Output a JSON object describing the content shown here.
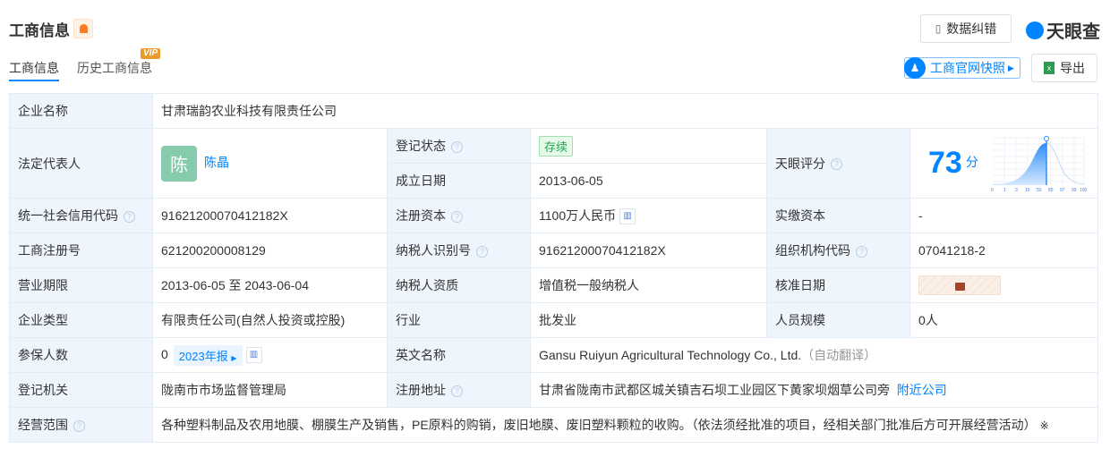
{
  "header": {
    "title": "工商信息",
    "tabs": [
      "工商信息",
      "历史工商信息"
    ],
    "vip": "VIP",
    "correct_btn": "数据纠错",
    "logo": "天眼查",
    "snapshot_btn": "工商官网快照",
    "export_btn": "导出"
  },
  "info": {
    "company_name_label": "企业名称",
    "company_name": "甘肃瑞韵农业科技有限责任公司",
    "legal_rep_label": "法定代表人",
    "legal_rep_avatar": "陈",
    "legal_rep": "陈晶",
    "status_label": "登记状态",
    "status": "存续",
    "founded_label": "成立日期",
    "founded": "2013-06-05",
    "score_label": "天眼评分",
    "score": "73",
    "score_unit": "分",
    "score_ticks": [
      "0",
      "1",
      "3",
      "15",
      "50",
      "85",
      "97",
      "99",
      "100"
    ],
    "credit_code_label": "统一社会信用代码",
    "credit_code": "91621200070412182X",
    "reg_capital_label": "注册资本",
    "reg_capital": "1100万人民币",
    "paid_capital_label": "实缴资本",
    "paid_capital": "-",
    "reg_no_label": "工商注册号",
    "reg_no": "621200200008129",
    "taxpayer_id_label": "纳税人识别号",
    "taxpayer_id": "91621200070412182X",
    "org_code_label": "组织机构代码",
    "org_code": "07041218-2",
    "term_label": "营业期限",
    "term": "2013-06-05 至 2043-06-04",
    "taxpayer_type_label": "纳税人资质",
    "taxpayer_type": "增值税一般纳税人",
    "approved_label": "核准日期",
    "type_label": "企业类型",
    "type": "有限责任公司(自然人投资或控股)",
    "industry_label": "行业",
    "industry": "批发业",
    "staff_label": "人员规模",
    "staff": "0人",
    "insured_label": "参保人数",
    "insured": "0",
    "report": "2023年报",
    "en_name_label": "英文名称",
    "en_name": "Gansu Ruiyun Agricultural Technology Co., Ltd.",
    "auto_translate": "（自动翻译）",
    "authority_label": "登记机关",
    "authority": "陇南市市场监督管理局",
    "address_label": "注册地址",
    "address": "甘肃省陇南市武都区城关镇吉石坝工业园区下黄家坝烟草公司旁",
    "nearby": "附近公司",
    "scope_label": "经营范围",
    "scope": "各种塑料制品及农用地膜、棚膜生产及销售，PE原料的购销，废旧地膜、废旧塑料颗粒的收购。（依法须经批准的项目，经相关部门批准后方可开展经营活动）",
    "scope_mark": "※"
  }
}
